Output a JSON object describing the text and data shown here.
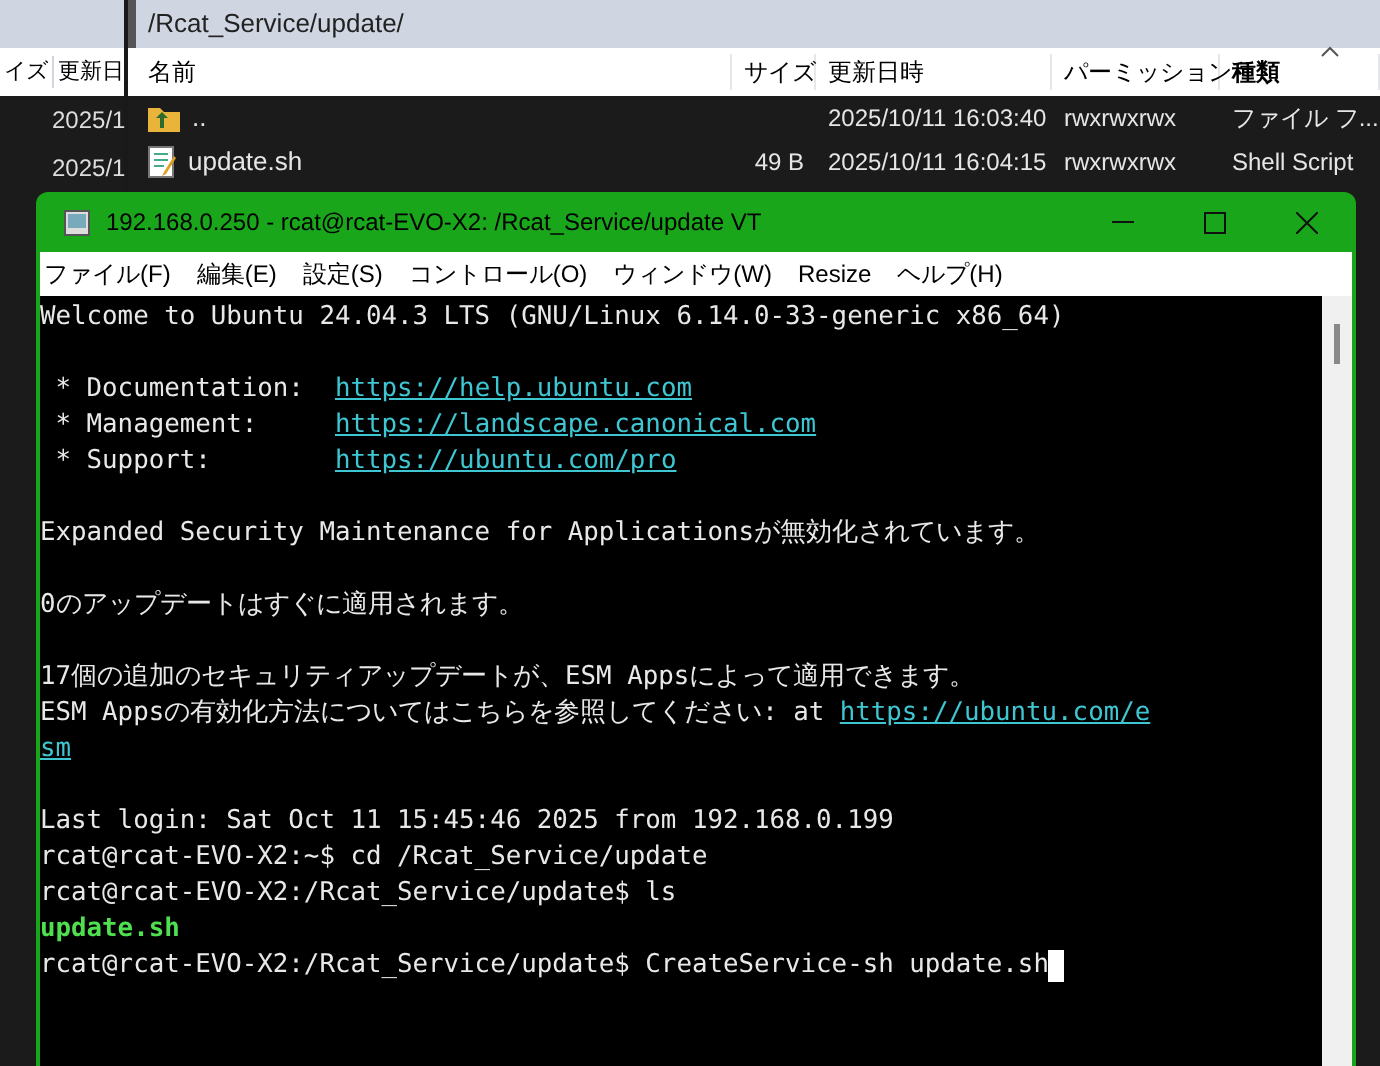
{
  "left_pane": {
    "columns": [
      "イズ",
      "更新日"
    ],
    "rows": [
      "2025/1",
      "2025/1"
    ]
  },
  "file_pane": {
    "path": "/Rcat_Service/update/",
    "columns": [
      {
        "label": "名前",
        "sorted": false
      },
      {
        "label": "サイズ",
        "sorted": false
      },
      {
        "label": "更新日時",
        "sorted": false
      },
      {
        "label": "パーミッション",
        "sorted": false
      },
      {
        "label": "種類",
        "sorted": true
      }
    ],
    "rows": [
      {
        "kind": "parent",
        "name": "..",
        "modified": "2025/10/11 16:03:40",
        "permissions": "rwxrwxrwx",
        "type": "ファイル フ..."
      },
      {
        "kind": "script",
        "name": "update.sh",
        "size": "49 B",
        "modified": "2025/10/11 16:04:15",
        "permissions": "rwxrwxrwx",
        "type": "Shell Script"
      }
    ]
  },
  "terminal": {
    "title": "192.168.0.250 - rcat@rcat-EVO-X2: /Rcat_Service/update VT",
    "menu": [
      "ファイル(F)",
      "編集(E)",
      "設定(S)",
      "コントロール(O)",
      "ウィンドウ(W)",
      "Resize",
      "ヘルプ(H)"
    ],
    "cursor_visible": true,
    "lines": [
      {
        "kind": "output",
        "segments": [
          {
            "kind": "text",
            "text": "Welcome to Ubuntu 24.04.3 LTS (GNU/Linux 6.14.0-33-generic x86_64)"
          }
        ]
      },
      {
        "kind": "blank"
      },
      {
        "kind": "output",
        "segments": [
          {
            "kind": "text",
            "text": " * Documentation:  "
          },
          {
            "kind": "link",
            "text": "https://help.ubuntu.com"
          }
        ]
      },
      {
        "kind": "output",
        "segments": [
          {
            "kind": "text",
            "text": " * Management:     "
          },
          {
            "kind": "link",
            "text": "https://landscape.canonical.com"
          }
        ]
      },
      {
        "kind": "output",
        "segments": [
          {
            "kind": "text",
            "text": " * Support:        "
          },
          {
            "kind": "link",
            "text": "https://ubuntu.com/pro"
          }
        ]
      },
      {
        "kind": "blank"
      },
      {
        "kind": "output",
        "segments": [
          {
            "kind": "text",
            "text": "Expanded Security Maintenance for Applicationsが無効化されています。"
          }
        ]
      },
      {
        "kind": "blank"
      },
      {
        "kind": "output",
        "segments": [
          {
            "kind": "text",
            "text": "0のアップデートはすぐに適用されます。"
          }
        ]
      },
      {
        "kind": "blank"
      },
      {
        "kind": "output",
        "segments": [
          {
            "kind": "text",
            "text": "17個の追加のセキュリティアップデートが、ESM Appsによって適用できます。"
          }
        ]
      },
      {
        "kind": "output",
        "segments": [
          {
            "kind": "text",
            "text": "ESM Appsの有効化方法についてはこちらを参照してください: at "
          },
          {
            "kind": "link",
            "text": "https://ubuntu.com/e"
          }
        ]
      },
      {
        "kind": "output",
        "segments": [
          {
            "kind": "link",
            "text": "sm"
          }
        ]
      },
      {
        "kind": "blank"
      },
      {
        "kind": "output",
        "segments": [
          {
            "kind": "text",
            "text": "Last login: Sat Oct 11 15:45:46 2025 from 192.168.0.199"
          }
        ]
      },
      {
        "kind": "output",
        "segments": [
          {
            "kind": "text",
            "text": "rcat@rcat-EVO-X2:~$ cd /Rcat_Service/update"
          }
        ]
      },
      {
        "kind": "output",
        "segments": [
          {
            "kind": "text",
            "text": "rcat@rcat-EVO-X2:/Rcat_Service/update$ ls"
          }
        ]
      },
      {
        "kind": "output",
        "segments": [
          {
            "kind": "executable",
            "text": "update.sh"
          }
        ]
      },
      {
        "kind": "output",
        "segments": [
          {
            "kind": "text",
            "text": "rcat@rcat-EVO-X2:/Rcat_Service/update$ CreateService-sh update.sh"
          }
        ]
      }
    ]
  }
}
